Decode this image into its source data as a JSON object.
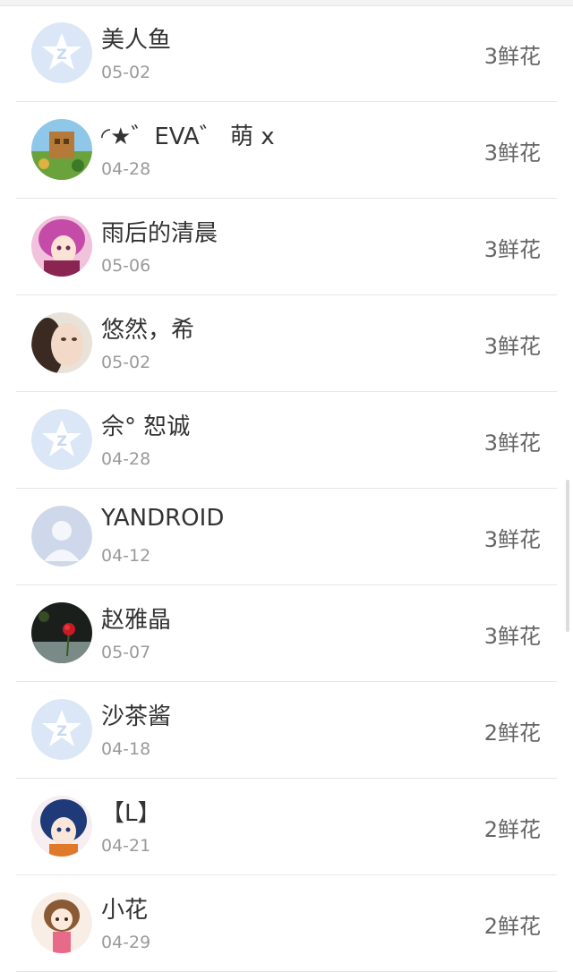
{
  "rows": [
    {
      "name": "美人鱼",
      "date": "05-02",
      "flowers": "3鲜花",
      "avatar": "qq-default-icon"
    },
    {
      "name": "◜★゛EVA゛ 萌 x",
      "date": "04-28",
      "flowers": "3鲜花",
      "avatar": "game-scene-photo"
    },
    {
      "name": "雨后的清晨",
      "date": "05-06",
      "flowers": "3鲜花",
      "avatar": "anime-girl-pink-photo"
    },
    {
      "name": "悠然，希",
      "date": "05-02",
      "flowers": "3鲜花",
      "avatar": "girl-face-photo"
    },
    {
      "name": "佘° 恕诚",
      "date": "04-28",
      "flowers": "3鲜花",
      "avatar": "qq-default-icon"
    },
    {
      "name": "YANDROID",
      "date": "04-12",
      "flowers": "3鲜花",
      "avatar": "default-person-icon"
    },
    {
      "name": "赵雅晶",
      "date": "05-07",
      "flowers": "3鲜花",
      "avatar": "rose-photo"
    },
    {
      "name": "沙茶酱",
      "date": "04-18",
      "flowers": "2鲜花",
      "avatar": "qq-default-icon"
    },
    {
      "name": "【L】",
      "date": "04-21",
      "flowers": "2鲜花",
      "avatar": "anime-girl-blue-photo"
    },
    {
      "name": "小花",
      "date": "04-29",
      "flowers": "2鲜花",
      "avatar": "cartoon-girl-photo"
    }
  ],
  "colors": {
    "name_text": "#333333",
    "date_text": "#9a9a9a",
    "flowers_text": "#666666",
    "divider": "#e6e6e6",
    "qq_default_bg": "#d6e4f5"
  }
}
